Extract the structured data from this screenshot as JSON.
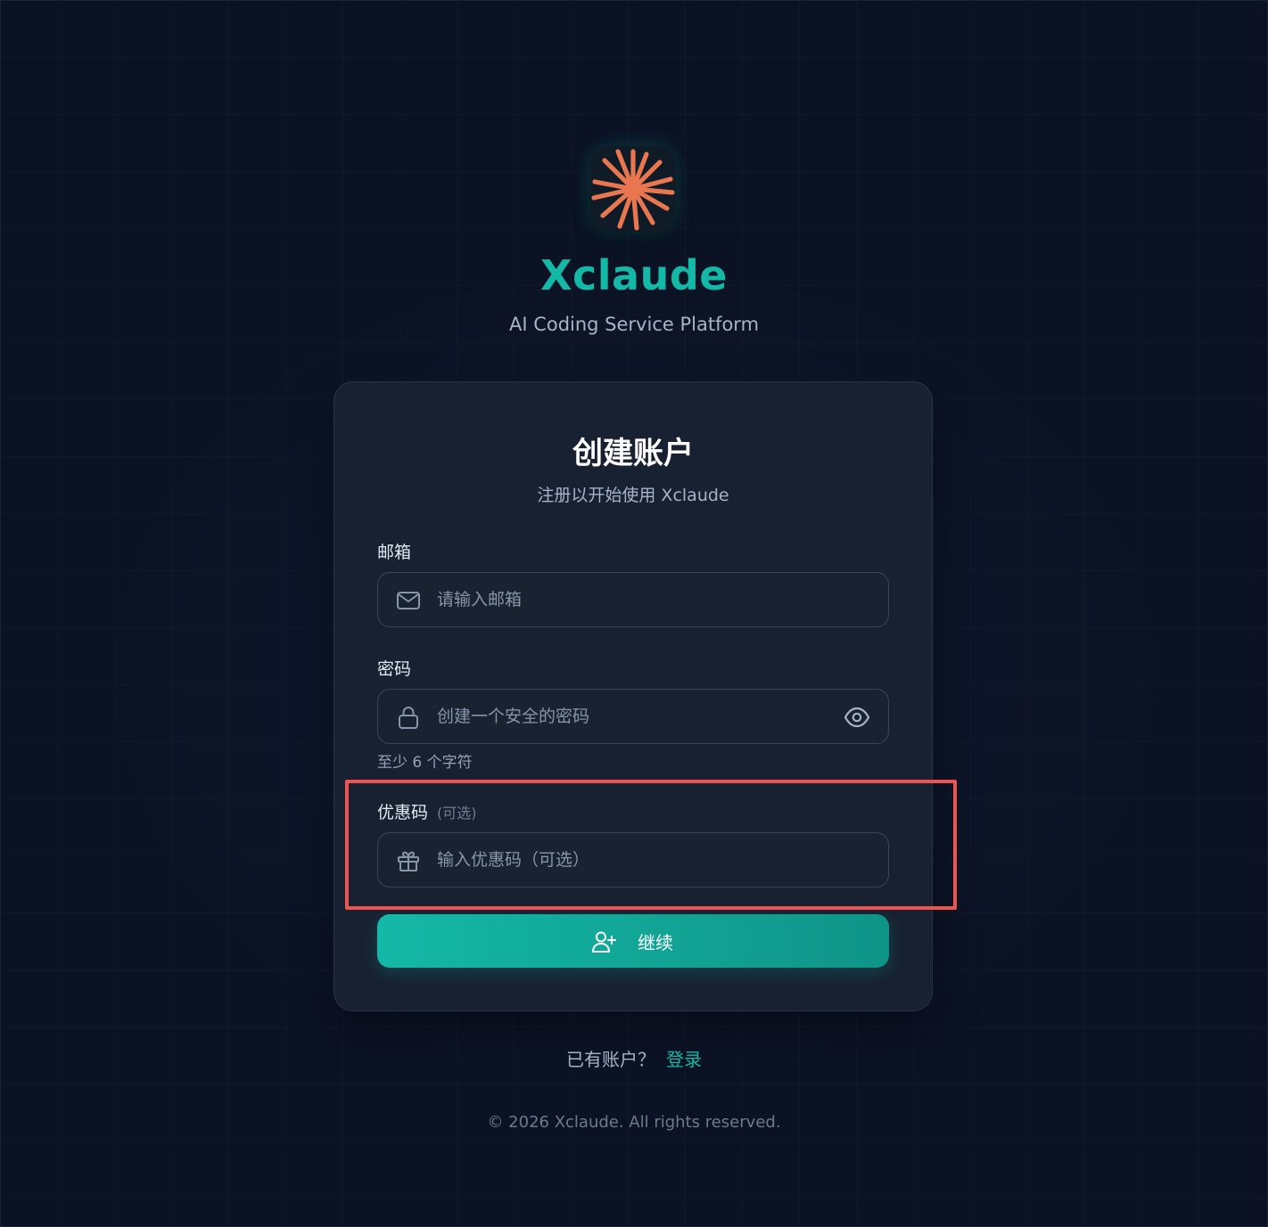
{
  "brand": {
    "logo_icon": "sunburst-logo-icon",
    "logo_color": "#e8774f",
    "name": "Xclaude",
    "tagline": "AI Coding Service Platform",
    "accent_color": "#14b8a6"
  },
  "card": {
    "title": "创建账户",
    "subtitle": "注册以开始使用 Xclaude"
  },
  "form": {
    "email": {
      "label": "邮箱",
      "placeholder": "请输入邮箱",
      "value": "",
      "icon": "mail-icon"
    },
    "password": {
      "label": "密码",
      "placeholder": "创建一个安全的密码",
      "value": "",
      "icon": "lock-icon",
      "toggle_icon": "eye-icon",
      "hint": "至少 6 个字符"
    },
    "promo": {
      "label": "优惠码",
      "optional_tag": "(可选)",
      "placeholder": "输入优惠码（可选）",
      "value": "",
      "icon": "gift-icon"
    },
    "submit": {
      "label": "继续",
      "icon": "user-plus-icon"
    }
  },
  "login_prompt": {
    "text": "已有账户？",
    "link_label": "登录"
  },
  "footer": {
    "text": "© 2026 Xclaude. All rights reserved."
  },
  "highlight": {
    "color": "#ef5350",
    "target": "promo-code-section"
  }
}
